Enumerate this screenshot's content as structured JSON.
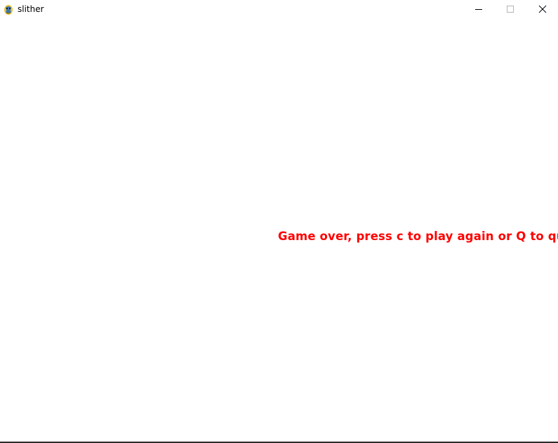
{
  "window": {
    "title": "slither",
    "icon": "pygame-snake-icon",
    "controls": [
      "minimize-icon",
      "maximize-icon",
      "close-icon"
    ]
  },
  "game": {
    "message": "Game over, press c to play again or Q to quit",
    "message_color": "#ff0000",
    "background_color": "#ffffff"
  }
}
